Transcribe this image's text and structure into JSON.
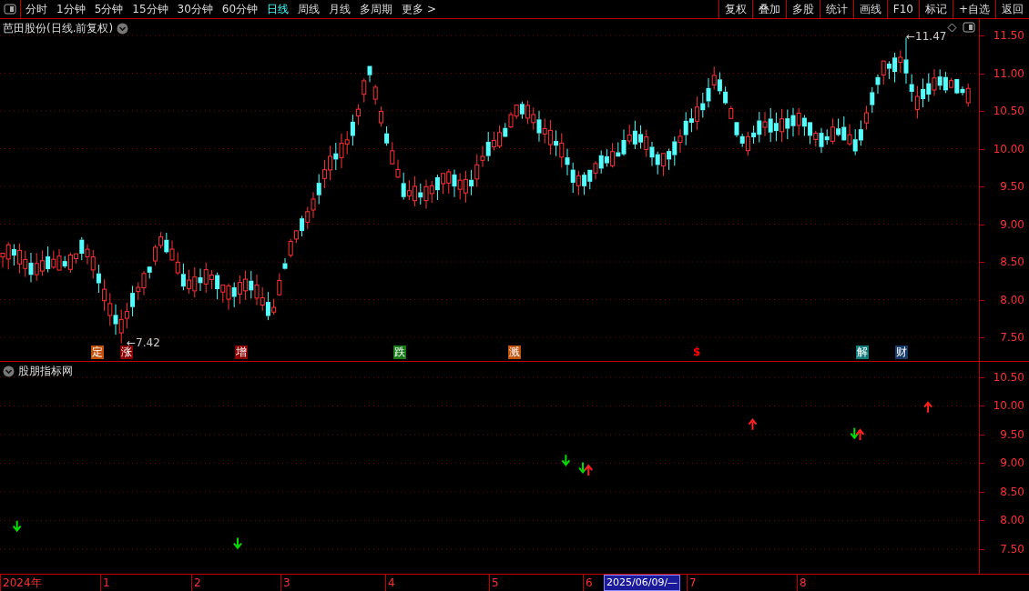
{
  "toolbar": {
    "periods": [
      {
        "label": "分时",
        "selected": false
      },
      {
        "label": "1分钟",
        "selected": false
      },
      {
        "label": "5分钟",
        "selected": false
      },
      {
        "label": "15分钟",
        "selected": false
      },
      {
        "label": "30分钟",
        "selected": false
      },
      {
        "label": "60分钟",
        "selected": false
      },
      {
        "label": "日线",
        "selected": true
      },
      {
        "label": "周线",
        "selected": false
      },
      {
        "label": "月线",
        "selected": false
      },
      {
        "label": "多周期",
        "selected": false
      },
      {
        "label": "更多 >",
        "selected": false
      }
    ],
    "buttons": [
      "复权",
      "叠加",
      "多股",
      "统计",
      "画线",
      "F10",
      "标记",
      "+自选",
      "返回"
    ]
  },
  "price_chart": {
    "title": "芭田股份(日线.前复权)",
    "high_label": "←11.47",
    "low_label": "←7.42",
    "price_axis": [
      "11.50",
      "11.00",
      "10.50",
      "10.00",
      "9.50",
      "9.00",
      "8.50",
      "8.00",
      "7.50"
    ],
    "events": [
      {
        "label": "定",
        "kind": "tag",
        "color": "#c0500a"
      },
      {
        "label": "涨",
        "kind": "tag",
        "color": "#8b0000"
      },
      {
        "label": "增",
        "kind": "tag",
        "color": "#8b0000"
      },
      {
        "label": "跌",
        "kind": "tag",
        "color": "#1a7a1a"
      },
      {
        "label": "溅",
        "kind": "tag",
        "color": "#c0500a"
      },
      {
        "label": "$",
        "kind": "glyph",
        "color": "#ff0000"
      },
      {
        "label": "解",
        "kind": "tag",
        "color": "#127a7a"
      },
      {
        "label": "财",
        "kind": "tag",
        "color": "#163a6a"
      }
    ]
  },
  "indicator": {
    "title": "股朋指标网",
    "axis": [
      "10.50",
      "10.00",
      "9.50",
      "9.00",
      "8.50",
      "8.00",
      "7.50"
    ]
  },
  "date_axis": [
    {
      "label": "2024年",
      "selected": false
    },
    {
      "label": "1",
      "selected": false
    },
    {
      "label": "2",
      "selected": false
    },
    {
      "label": "3",
      "selected": false
    },
    {
      "label": "4",
      "selected": false
    },
    {
      "label": "5",
      "selected": false
    },
    {
      "label": "6",
      "selected": false
    },
    {
      "label": "2025/06/09/—",
      "selected": true
    },
    {
      "label": "7",
      "selected": false
    },
    {
      "label": "8",
      "selected": false
    }
  ]
}
